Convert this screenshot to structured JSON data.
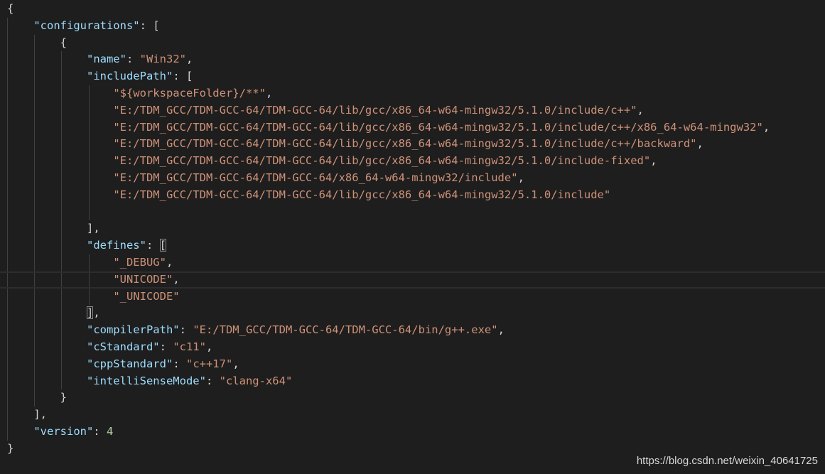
{
  "editor": {
    "lines": [
      [
        [
          "p",
          "{"
        ]
      ],
      [
        [
          "p",
          "    "
        ],
        [
          "k",
          "\"configurations\""
        ],
        [
          "p",
          ": ["
        ]
      ],
      [
        [
          "p",
          "        {"
        ]
      ],
      [
        [
          "p",
          "            "
        ],
        [
          "k",
          "\"name\""
        ],
        [
          "p",
          ": "
        ],
        [
          "s",
          "\"Win32\""
        ],
        [
          "p",
          ","
        ]
      ],
      [
        [
          "p",
          "            "
        ],
        [
          "k",
          "\"includePath\""
        ],
        [
          "p",
          ": ["
        ]
      ],
      [
        [
          "p",
          "                "
        ],
        [
          "s",
          "\"${workspaceFolder}/**\""
        ],
        [
          "p",
          ","
        ]
      ],
      [
        [
          "p",
          "                "
        ],
        [
          "s",
          "\"E:/TDM_GCC/TDM-GCC-64/TDM-GCC-64/lib/gcc/x86_64-w64-mingw32/5.1.0/include/c++\""
        ],
        [
          "p",
          ","
        ]
      ],
      [
        [
          "p",
          "                "
        ],
        [
          "s",
          "\"E:/TDM_GCC/TDM-GCC-64/TDM-GCC-64/lib/gcc/x86_64-w64-mingw32/5.1.0/include/c++/x86_64-w64-mingw32\""
        ],
        [
          "p",
          ","
        ]
      ],
      [
        [
          "p",
          "                "
        ],
        [
          "s",
          "\"E:/TDM_GCC/TDM-GCC-64/TDM-GCC-64/lib/gcc/x86_64-w64-mingw32/5.1.0/include/c++/backward\""
        ],
        [
          "p",
          ","
        ]
      ],
      [
        [
          "p",
          "                "
        ],
        [
          "s",
          "\"E:/TDM_GCC/TDM-GCC-64/TDM-GCC-64/lib/gcc/x86_64-w64-mingw32/5.1.0/include-fixed\""
        ],
        [
          "p",
          ","
        ]
      ],
      [
        [
          "p",
          "                "
        ],
        [
          "s",
          "\"E:/TDM_GCC/TDM-GCC-64/TDM-GCC-64/x86_64-w64-mingw32/include\""
        ],
        [
          "p",
          ","
        ]
      ],
      [
        [
          "p",
          "                "
        ],
        [
          "s",
          "\"E:/TDM_GCC/TDM-GCC-64/TDM-GCC-64/lib/gcc/x86_64-w64-mingw32/5.1.0/include\""
        ]
      ],
      [],
      [
        [
          "p",
          "            ],"
        ]
      ],
      [
        [
          "p",
          "            "
        ],
        [
          "k",
          "\"defines\""
        ],
        [
          "p",
          ": "
        ],
        [
          "b",
          "["
        ]
      ],
      [
        [
          "p",
          "                "
        ],
        [
          "s",
          "\"_DEBUG\""
        ],
        [
          "p",
          ","
        ]
      ],
      [
        [
          "p",
          "                "
        ],
        [
          "s",
          "\"UNICODE\""
        ],
        [
          "p",
          ","
        ]
      ],
      [
        [
          "p",
          "                "
        ],
        [
          "s",
          "\"_UNICODE\""
        ]
      ],
      [
        [
          "p",
          "            "
        ],
        [
          "b",
          "]"
        ],
        [
          "p",
          ","
        ]
      ],
      [
        [
          "p",
          "            "
        ],
        [
          "k",
          "\"compilerPath\""
        ],
        [
          "p",
          ": "
        ],
        [
          "s",
          "\"E:/TDM_GCC/TDM-GCC-64/TDM-GCC-64/bin/g++.exe\""
        ],
        [
          "p",
          ","
        ]
      ],
      [
        [
          "p",
          "            "
        ],
        [
          "k",
          "\"cStandard\""
        ],
        [
          "p",
          ": "
        ],
        [
          "s",
          "\"c11\""
        ],
        [
          "p",
          ","
        ]
      ],
      [
        [
          "p",
          "            "
        ],
        [
          "k",
          "\"cppStandard\""
        ],
        [
          "p",
          ": "
        ],
        [
          "s",
          "\"c++17\""
        ],
        [
          "p",
          ","
        ]
      ],
      [
        [
          "p",
          "            "
        ],
        [
          "k",
          "\"intelliSenseMode\""
        ],
        [
          "p",
          ": "
        ],
        [
          "s",
          "\"clang-x64\""
        ]
      ],
      [
        [
          "p",
          "        }"
        ]
      ],
      [
        [
          "p",
          "    ],"
        ]
      ],
      [
        [
          "p",
          "    "
        ],
        [
          "k",
          "\"version\""
        ],
        [
          "p",
          ": "
        ],
        [
          "n",
          "4"
        ]
      ],
      [
        [
          "p",
          "}"
        ]
      ]
    ]
  },
  "colors": {
    "background": "#1e1e1e",
    "key": "#9cdcfe",
    "string": "#ce9178",
    "number": "#b5cea8",
    "punctuation": "#d4d4d4"
  },
  "watermark": "https://blog.csdn.net/weixin_40641725"
}
